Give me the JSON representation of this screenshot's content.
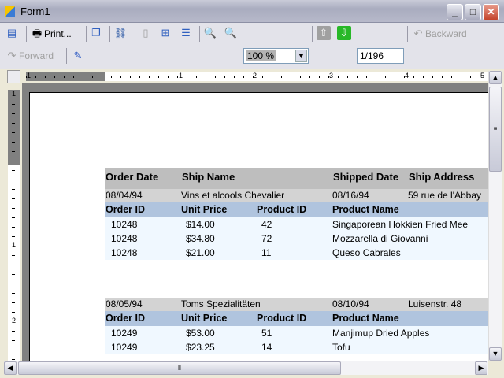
{
  "window": {
    "title": "Form1"
  },
  "toolbar": {
    "print_label": "Print...",
    "zoom_value": "100 %",
    "page_value": "1/196",
    "backward_label": "Backward",
    "forward_label": "Forward"
  },
  "ruler": {
    "h_labels": [
      "1",
      "1",
      "2",
      "3",
      "4",
      "5"
    ],
    "v_labels": [
      "1",
      "1",
      "2"
    ]
  },
  "report": {
    "header": {
      "order_date": "Order Date",
      "ship_name": "Ship Name",
      "shipped_date": "Shipped Date",
      "ship_address": "Ship Address"
    },
    "detail_header": {
      "order_id": "Order ID",
      "unit_price": "Unit Price",
      "product_id": "Product ID",
      "product_name": "Product Name"
    },
    "groups": [
      {
        "order_date": "08/04/94",
        "ship_name": "Vins et alcools Chevalier",
        "shipped_date": "08/16/94",
        "ship_address": "59 rue de l'Abbay",
        "items": [
          {
            "order_id": "10248",
            "unit_price": "$14.00",
            "product_id": "42",
            "product_name": "Singaporean Hokkien Fried Mee"
          },
          {
            "order_id": "10248",
            "unit_price": "$34.80",
            "product_id": "72",
            "product_name": "Mozzarella di Giovanni"
          },
          {
            "order_id": "10248",
            "unit_price": "$21.00",
            "product_id": "11",
            "product_name": "Queso Cabrales"
          }
        ]
      },
      {
        "order_date": "08/05/94",
        "ship_name": "Toms Spezialitäten",
        "shipped_date": "08/10/94",
        "ship_address": "Luisenstr. 48",
        "items": [
          {
            "order_id": "10249",
            "unit_price": "$53.00",
            "product_id": "51",
            "product_name": "Manjimup Dried Apples"
          },
          {
            "order_id": "10249",
            "unit_price": "$23.25",
            "product_id": "14",
            "product_name": "Tofu"
          }
        ]
      }
    ]
  }
}
